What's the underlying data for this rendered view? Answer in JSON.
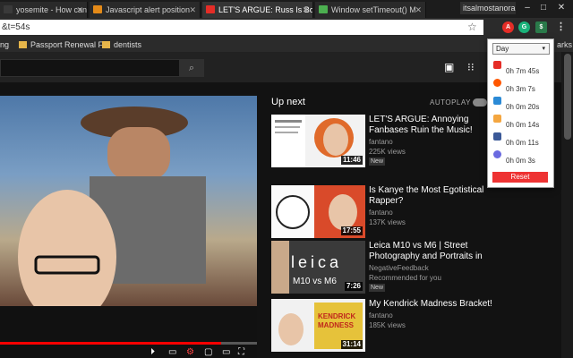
{
  "tabs": [
    {
      "title": "yosemite - How can I che",
      "favicon_color": "#3a3a3a"
    },
    {
      "title": "Javascript alert position",
      "favicon_color": "#e48a18"
    },
    {
      "title": "LET'S ARGUE: Russ Is Bor",
      "favicon_color": "#e52d27"
    },
    {
      "title": "Window setTimeout() M",
      "favicon_color": "#4caf50"
    }
  ],
  "profile_name": "itsalmostanora",
  "address": {
    "url_fragment": "&t=54s"
  },
  "bookmarks": [
    {
      "label": "ng"
    },
    {
      "label": "Passport Renewal For"
    },
    {
      "label": "dentists"
    },
    {
      "label": "arks"
    }
  ],
  "player": {
    "progress": 0.86
  },
  "sidebar": {
    "up_next_label": "Up next",
    "autoplay_label": "AUTOPLAY",
    "videos": [
      {
        "title": "LET'S ARGUE: Annoying Fanbases Ruin the Music!",
        "channel": "fantano",
        "views": "225K views",
        "badge": "New",
        "duration": "11:46",
        "thumb_color": "#e8e8e8"
      },
      {
        "title": "Is Kanye the Most Egotistical Rapper?",
        "channel": "fantano",
        "views": "137K views",
        "badge": "",
        "duration": "17:55",
        "thumb_color": "#d94a2a"
      },
      {
        "title": "Leica M10 vs M6 | Street Photography and Portraits in",
        "channel": "NegativeFeedback",
        "views": "Recommended for you",
        "badge": "New",
        "duration": "7:26",
        "thumb_color": "#4a4a4a"
      },
      {
        "title": "My Kendrick Madness Bracket!",
        "channel": "fantano",
        "views": "185K views",
        "badge": "",
        "duration": "31:14",
        "thumb_color": "#e6c23a"
      }
    ]
  },
  "popup": {
    "period_label": "Day",
    "sites": [
      {
        "icon": "youtube-icon",
        "color": "#e52d27",
        "time": "0h 7m 45s"
      },
      {
        "icon": "reddit-icon",
        "color": "#ff5700",
        "time": "0h 3m 7s"
      },
      {
        "icon": "stackoverflow-icon",
        "color": "#2b8ad6",
        "time": "0h 0m 20s"
      },
      {
        "icon": "wordpress-icon",
        "color": "#f4a640",
        "time": "0h 0m 14s"
      },
      {
        "icon": "facebook-icon",
        "color": "#3b5998",
        "time": "0h 0m 11s"
      },
      {
        "icon": "globe-icon",
        "color": "#6a6ae0",
        "time": "0h 0m 3s"
      }
    ],
    "reset_label": "Reset"
  }
}
